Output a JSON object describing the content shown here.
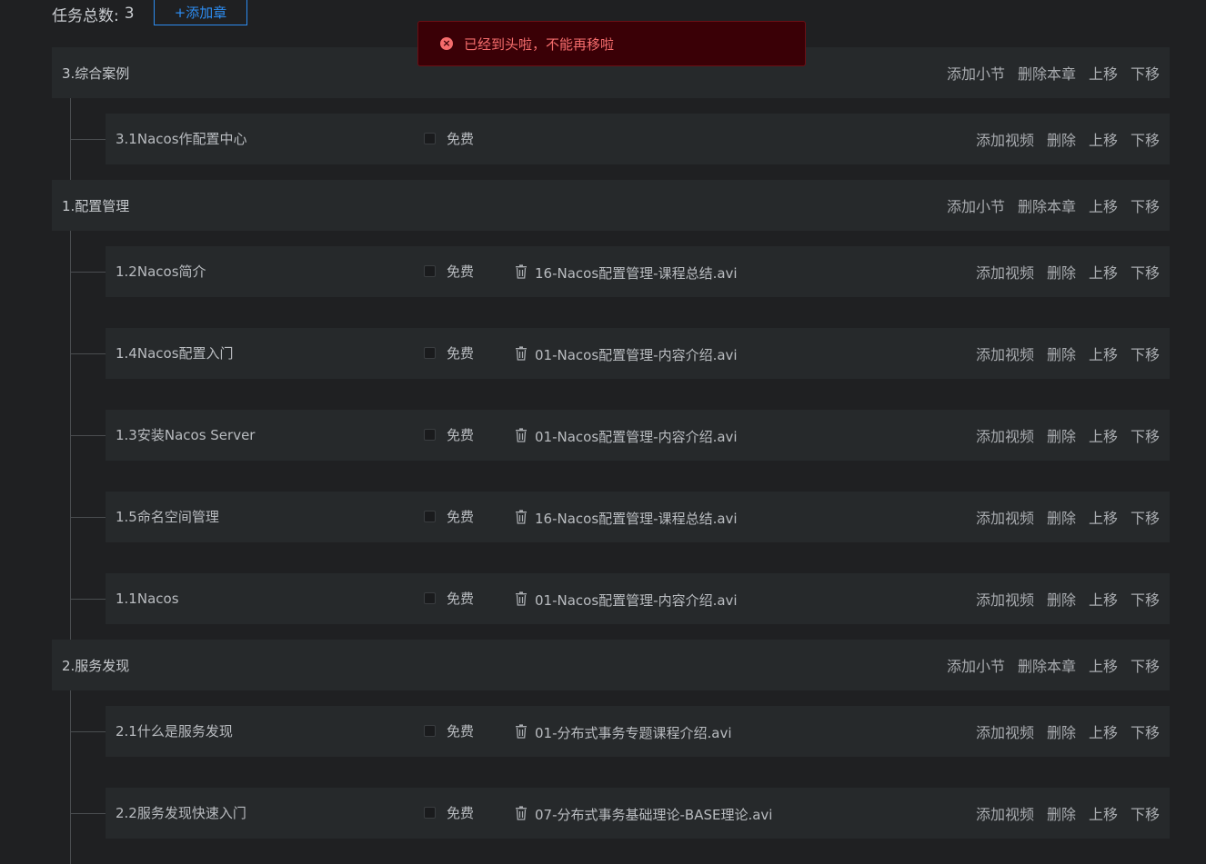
{
  "header": {
    "total_label": "任务总数:",
    "total_count": "3",
    "add_chapter": "+添加章"
  },
  "toast": {
    "message": "已经到头啦，不能再移啦",
    "icon": "error-circle-icon",
    "color": "#f56c6c"
  },
  "chapter_actions": {
    "add_section": "添加小节",
    "delete_chapter": "删除本章",
    "move_up": "上移",
    "move_down": "下移"
  },
  "section_actions": {
    "add_video": "添加视频",
    "delete": "删除",
    "move_up": "上移",
    "move_down": "下移"
  },
  "free_label": "免费",
  "chapters": [
    {
      "title": "3.综合案例",
      "sections": [
        {
          "title": "3.1Nacos作配置中心",
          "video": ""
        }
      ]
    },
    {
      "title": "1.配置管理",
      "sections": [
        {
          "title": "1.2Nacos简介",
          "video": "16-Nacos配置管理-课程总结.avi"
        },
        {
          "title": "1.4Nacos配置入门",
          "video": "01-Nacos配置管理-内容介绍.avi"
        },
        {
          "title": "1.3安装Nacos Server",
          "video": "01-Nacos配置管理-内容介绍.avi"
        },
        {
          "title": "1.5命名空间管理",
          "video": "16-Nacos配置管理-课程总结.avi"
        },
        {
          "title": "1.1Nacos",
          "video": "01-Nacos配置管理-内容介绍.avi"
        }
      ]
    },
    {
      "title": "2.服务发现",
      "sections": [
        {
          "title": "2.1什么是服务发现",
          "video": "01-分布式事务专题课程介绍.avi"
        },
        {
          "title": "2.2服务发现快速入门",
          "video": "07-分布式事务基础理论-BASE理论.avi"
        }
      ]
    }
  ]
}
